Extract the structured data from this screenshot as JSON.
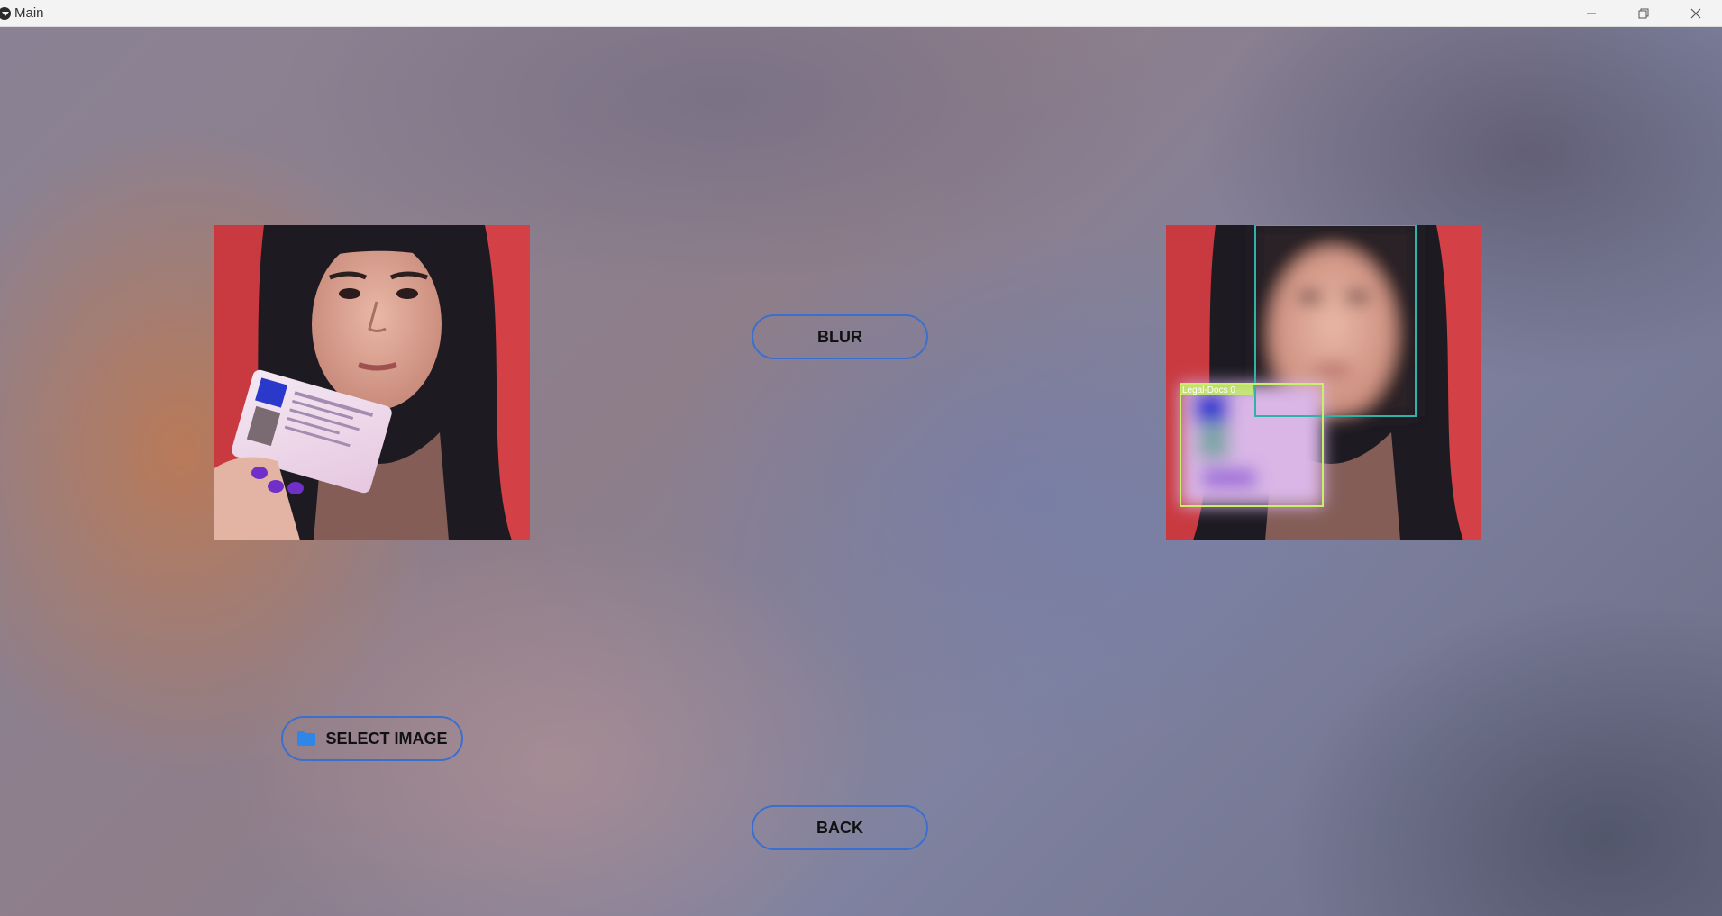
{
  "window": {
    "title": "Main",
    "controls": [
      "minimize-icon",
      "restore-icon",
      "close-icon"
    ]
  },
  "buttons": {
    "blur_label": "BLUR",
    "select_image_label": "SELECT IMAGE",
    "select_image_icon": "folder-icon",
    "back_label": "BACK"
  },
  "output_image": {
    "detection_label": "Legal-Docs 0"
  },
  "colors": {
    "button_border": "#3a6fd0",
    "folder_icon": "#2f86e8",
    "face_box": "#2fb3a6",
    "doc_box": "#c8f06a"
  }
}
